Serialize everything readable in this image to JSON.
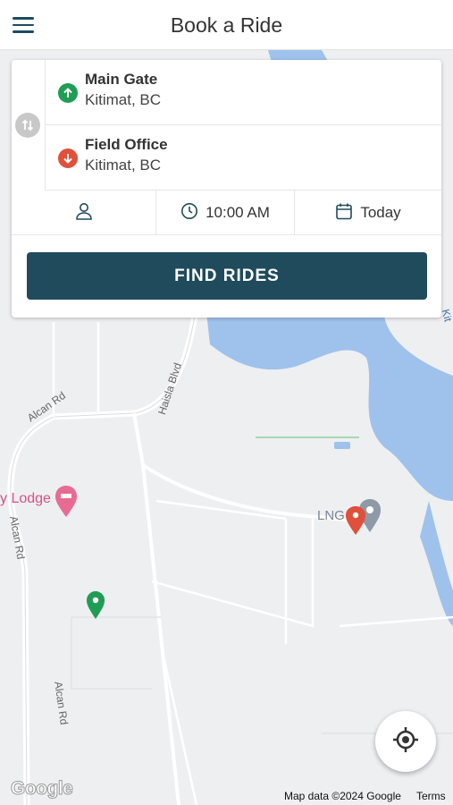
{
  "header": {
    "title": "Book a Ride",
    "menu_icon": "hamburger-menu-icon"
  },
  "trip": {
    "origin": {
      "name": "Main Gate",
      "city": "Kitimat, BC",
      "icon": "arrow-up-icon",
      "color": "#1f9d55"
    },
    "destination": {
      "name": "Field Office",
      "city": "Kitimat, BC",
      "icon": "arrow-down-icon",
      "color": "#e0503a"
    },
    "swap_icon": "swap-icon"
  },
  "options": {
    "passenger_icon": "person-icon",
    "time": "10:00 AM",
    "time_icon": "clock-icon",
    "date": "Today",
    "date_icon": "calendar-icon"
  },
  "find_rides_label": "FIND RIDES",
  "map": {
    "road_labels": [
      "Alcan Rd",
      "Haisla Blvd",
      "Alcan Rd",
      "Alcan Rd",
      "Kit"
    ],
    "poi_lodge": "y Lodge",
    "poi_lng": "LNG",
    "google_logo": "Google",
    "attribution": "Map data ©2024 Google",
    "terms": "Terms",
    "locate_icon": "crosshair-locate-icon",
    "water_color": "#9fc2ec",
    "accent": "#1f4b5c"
  }
}
